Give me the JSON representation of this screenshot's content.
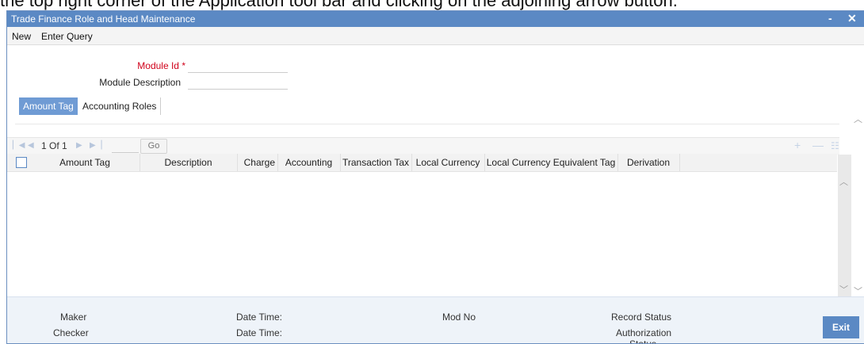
{
  "doc_strip_text": "the top right corner of the Application tool bar and clicking on the adjoining arrow button.",
  "window": {
    "title": "Trade Finance Role and Head Maintenance",
    "minimize_glyph": "-",
    "close_glyph": "✕"
  },
  "menu": {
    "new_label": "New",
    "enter_query_label": "Enter Query"
  },
  "form": {
    "module_id_label": "Module Id",
    "required_mark": "*",
    "module_id_value": "",
    "module_description_label": "Module Description",
    "module_description_value": ""
  },
  "tabs": [
    {
      "label": "Amount Tag",
      "active": true
    },
    {
      "label": "Accounting Roles",
      "active": false
    }
  ],
  "pager": {
    "text": "1 Of 1",
    "go_label": "Go",
    "page_input": ""
  },
  "table": {
    "columns": [
      "Amount Tag",
      "Description",
      "Charge",
      "Accounting",
      "Transaction Tax",
      "Local Currency",
      "Local Currency Equivalent Tag",
      "Derivation"
    ],
    "rows": []
  },
  "footer": {
    "maker_label": "Maker",
    "checker_label": "Checker",
    "date_time_label_1": "Date Time:",
    "date_time_label_2": "Date Time:",
    "mod_no_label": "Mod No",
    "record_status_label": "Record Status",
    "authorization_status_label": "Authorization Status",
    "exit_label": "Exit"
  },
  "colors": {
    "titlebar": "#5b89c4",
    "active_tab": "#6f9bd4",
    "required": "#d0021b",
    "footer_bg": "#eef3f9"
  }
}
